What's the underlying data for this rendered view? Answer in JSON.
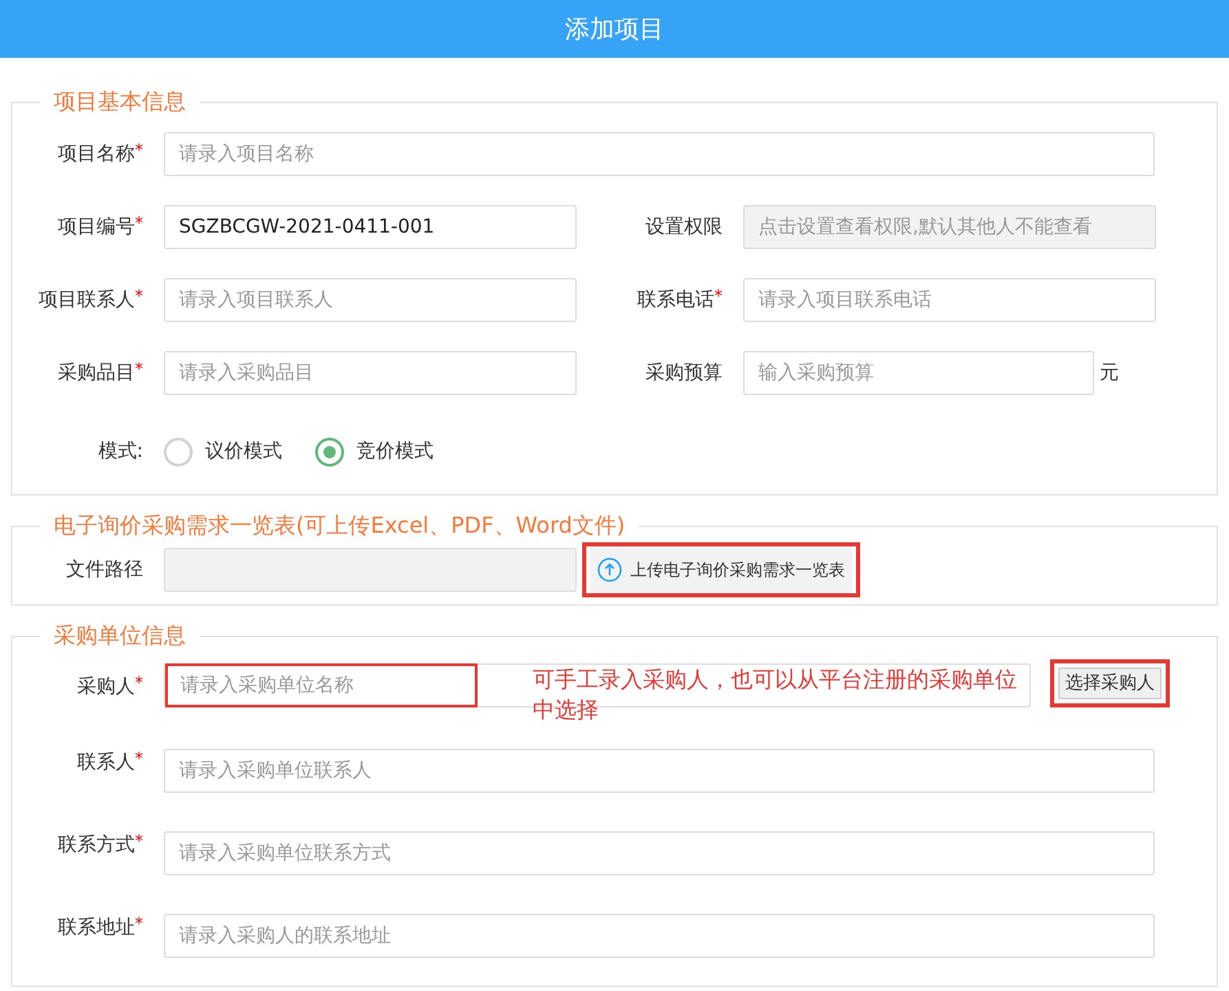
{
  "header": {
    "title": "添加项目"
  },
  "basic": {
    "legend": "项目基本信息",
    "rows": [
      [
        {
          "label": "项目名称",
          "required": "*",
          "placeholder": "请录入项目名称"
        }
      ],
      [
        {
          "label": "项目编号",
          "required": "*",
          "value": "SGZBCGW-2021-0411-001"
        },
        {
          "label": "设置权限",
          "placeholder": "点击设置查看权限,默认其他人不能查看",
          "disabled": true
        }
      ],
      [
        {
          "label": "项目联系人",
          "required": "*",
          "placeholder": "请录入项目联系人"
        },
        {
          "label": "联系电话",
          "required": "*",
          "placeholder": "请录入项目联系电话"
        }
      ],
      [
        {
          "label": "采购品目",
          "required": "*",
          "placeholder": "请录入采购品目"
        },
        {
          "label": "采购预算",
          "placeholder": "输入采购预算",
          "suffix": "元"
        }
      ]
    ],
    "mode": {
      "label": "模式:",
      "options": [
        {
          "label": "议价模式",
          "selected": false
        },
        {
          "label": "竞价模式",
          "selected": true
        }
      ]
    }
  },
  "upload": {
    "legend": "电子询价采购需求一览表(可上传Excel、PDF、Word文件)",
    "label": "文件路径",
    "button": "上传电子询价采购需求一览表",
    "highlighted": true
  },
  "purchaser": {
    "legend": "采购单位信息",
    "buyer": {
      "label": "采购人",
      "required": "*",
      "placeholder": "请录入采购单位名称",
      "highlighted": true
    },
    "note": "可手工录入采购人，也可以从平台注册的采购单位中选择",
    "select_button": {
      "label": "选择采购人",
      "highlighted": true
    },
    "rows": [
      {
        "label": "联系人",
        "required": "*",
        "placeholder": "请录入采购单位联系人"
      },
      {
        "label": "联系方式",
        "required": "*",
        "placeholder": "请录入采购单位联系方式"
      },
      {
        "label": "联系地址",
        "required": "*",
        "placeholder": "请录入采购人的联系地址"
      }
    ]
  }
}
